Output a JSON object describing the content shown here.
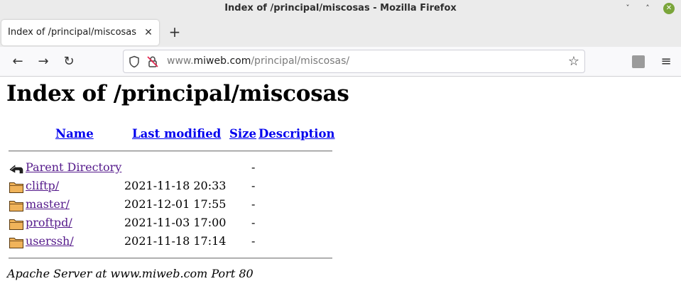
{
  "window": {
    "title": "Index of /principal/miscosas - Mozilla Firefox",
    "minimize_glyph": "ˇ",
    "maximize_glyph": "˄",
    "close_glyph": "✕"
  },
  "tabs": [
    {
      "label": "Index of /principal/miscosas",
      "close_glyph": "✕"
    }
  ],
  "new_tab_glyph": "+",
  "nav": {
    "back_glyph": "←",
    "forward_glyph": "→",
    "reload_glyph": "↻",
    "menu_glyph": "≡",
    "bookmark_glyph": "☆"
  },
  "url": {
    "prefix": "www.",
    "host": "miweb.com",
    "path": "/principal/miscosas/"
  },
  "page": {
    "heading": "Index of /principal/miscosas",
    "columns": {
      "name": "Name",
      "last_modified": "Last modified",
      "size": "Size",
      "description": "Description"
    },
    "entries": [
      {
        "icon": "parent-directory-icon",
        "name": "Parent Directory",
        "modified": "",
        "size": "-"
      },
      {
        "icon": "folder-icon",
        "name": "cliftp/",
        "modified": "2021-11-18 20:33",
        "size": "-"
      },
      {
        "icon": "folder-icon",
        "name": "master/",
        "modified": "2021-12-01 17:55",
        "size": "-"
      },
      {
        "icon": "folder-icon",
        "name": "proftpd/",
        "modified": "2021-11-03 17:00",
        "size": "-"
      },
      {
        "icon": "folder-icon",
        "name": "userssh/",
        "modified": "2021-11-18 17:14",
        "size": "-"
      }
    ],
    "footer": "Apache Server at www.miweb.com Port 80"
  },
  "colors": {
    "link_unvisited": "#0000ee",
    "link_visited": "#551a8b",
    "folder_fill": "#f0b35a",
    "close_button": "#7aa53a"
  }
}
